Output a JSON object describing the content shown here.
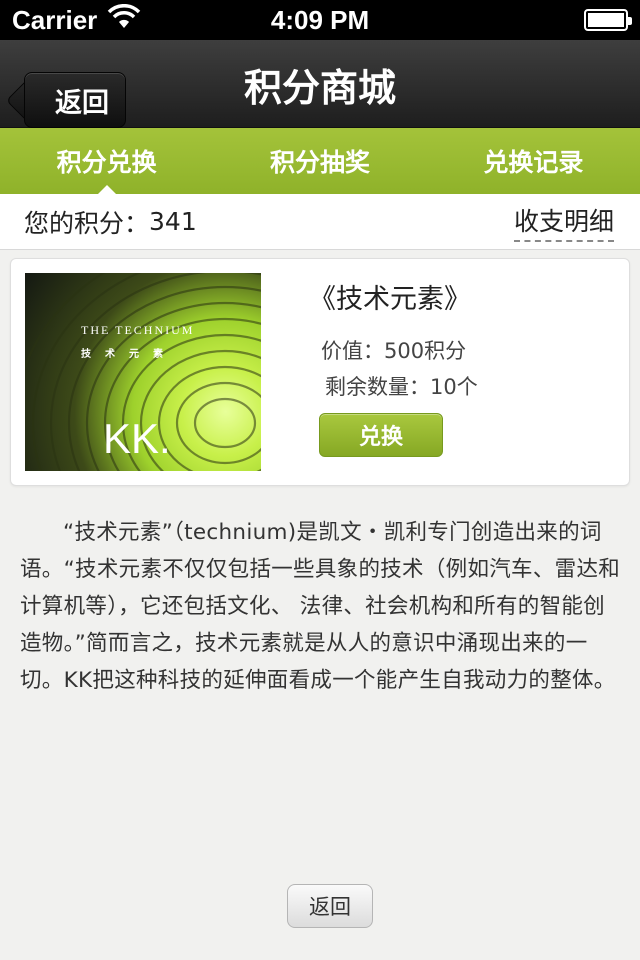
{
  "status_bar": {
    "carrier": "Carrier",
    "time": "4:09 PM"
  },
  "nav": {
    "back_label": "返回",
    "title": "积分商城"
  },
  "tabs": [
    {
      "label": "积分兑换",
      "active": true
    },
    {
      "label": "积分抽奖",
      "active": false
    },
    {
      "label": "兑换记录",
      "active": false
    }
  ],
  "points": {
    "label": "您的积分：",
    "value": "341",
    "detail_link": "收支明细"
  },
  "product": {
    "cover": {
      "title_en": "THE TECHNIUM",
      "title_cn": "技术元素",
      "brand": "KK."
    },
    "title": "《技术元素》",
    "price": "价值：500积分",
    "stock": "剩余数量：10个",
    "exchange_label": "兑换"
  },
  "description": "“技术元素”（technium)是凯文・凯利专门创造出来的词语。“技术元素不仅仅包括一些具象的技术（例如汽车、雷达和计算机等），它还包括文化、 法律、社会机构和所有的智能创造物。”简而言之，技术元素就是从人的意识中涌现出来的一切。KK把这种科技的延伸面看成一个能产生自我动力的整体。",
  "bottom_back_label": "返回",
  "colors": {
    "tab_green": "#9bbd33",
    "nav_dark": "#2b2b2b",
    "button_green": "#95b52c"
  }
}
